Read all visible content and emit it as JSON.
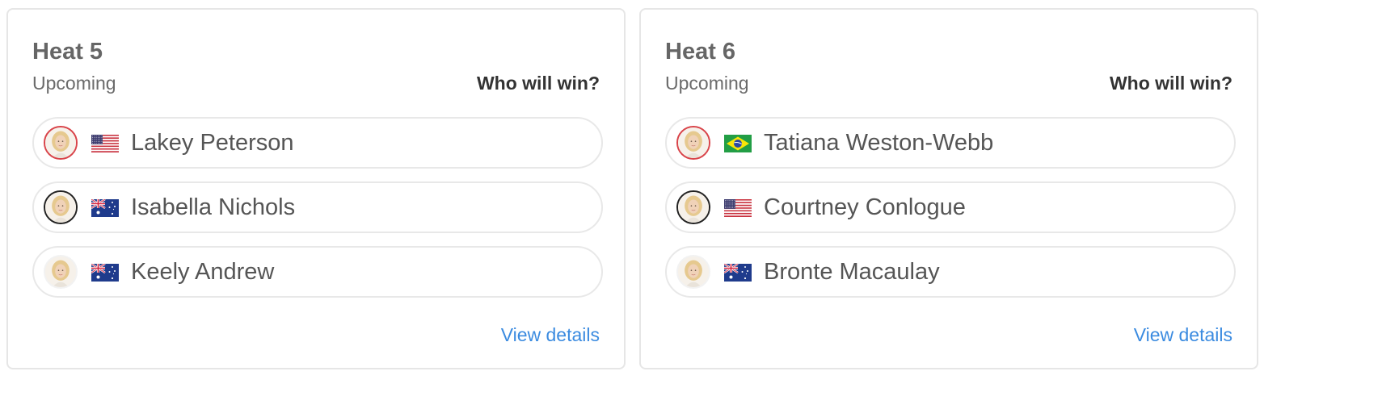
{
  "heats": [
    {
      "title": "Heat 5",
      "status": "Upcoming",
      "prompt": "Who will win?",
      "view_details": "View details",
      "surfers": [
        {
          "name": "Lakey Peterson",
          "country": "USA",
          "flag": "us-flag-icon",
          "ring": "red"
        },
        {
          "name": "Isabella Nichols",
          "country": "Australia",
          "flag": "au-flag-icon",
          "ring": "dark"
        },
        {
          "name": "Keely Andrew",
          "country": "Australia",
          "flag": "au-flag-icon",
          "ring": "none"
        }
      ]
    },
    {
      "title": "Heat 6",
      "status": "Upcoming",
      "prompt": "Who will win?",
      "view_details": "View details",
      "surfers": [
        {
          "name": "Tatiana Weston-Webb",
          "country": "Brazil",
          "flag": "br-flag-icon",
          "ring": "red"
        },
        {
          "name": "Courtney Conlogue",
          "country": "USA",
          "flag": "us-flag-icon",
          "ring": "dark"
        },
        {
          "name": "Bronte Macaulay",
          "country": "Australia",
          "flag": "au-flag-icon",
          "ring": "none"
        }
      ]
    }
  ],
  "colors": {
    "link": "#3b8be0",
    "ring_red": "#d9444a",
    "ring_dark": "#222222",
    "card_border": "#e6e6e6"
  }
}
